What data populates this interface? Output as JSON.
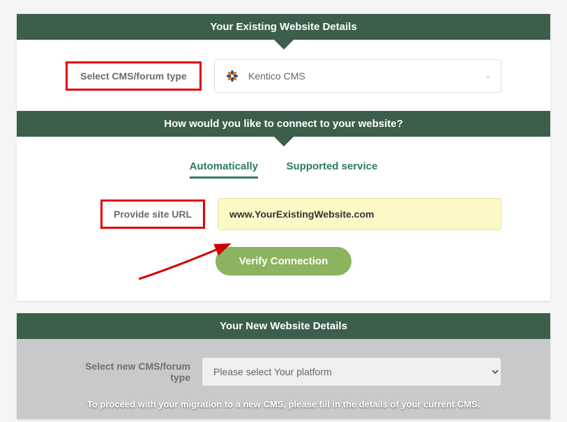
{
  "section1": {
    "title": "Your Existing Website Details",
    "cms_label": "Select CMS/forum type",
    "cms_value": "Kentico CMS"
  },
  "section2": {
    "title": "How would you like to connect to your website?",
    "tab_auto": "Automatically",
    "tab_supported": "Supported service",
    "url_label": "Provide site URL",
    "url_value": "www.YourExistingWebsite.com",
    "verify_btn": "Verify Connection"
  },
  "section3": {
    "title": "Your New Website Details",
    "new_label": "Select new CMS/forum type",
    "new_placeholder": "Please select Your platform",
    "hint": "To proceed with your migration to a new CMS, please fill in the details of your current CMS."
  }
}
